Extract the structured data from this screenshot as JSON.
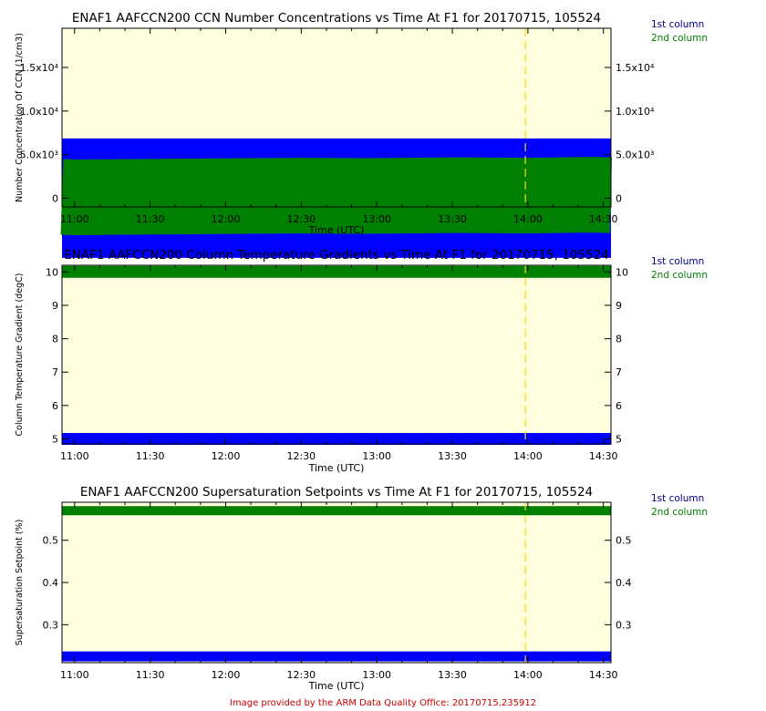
{
  "colors": {
    "plot_bg": "#ffffe0",
    "first_column": "#0000ff",
    "second_column": "#008000",
    "marker_line": "#ffd700",
    "credit": "#cc0000"
  },
  "legend": {
    "first": "1st column",
    "second": "2nd column"
  },
  "credit": "Image provided by the ARM Data Quality Office: 20170715.235912",
  "chart_data": [
    {
      "type": "line",
      "title": "ENAF1 AAFCCN200 CCN Number Concentrations vs Time At F1 for 20170715, 105524",
      "xlabel": "Time (UTC)",
      "ylabel": "Number Concentration Of CCN (1/cm3)",
      "x_ticks": [
        "11:00",
        "11:30",
        "12:00",
        "12:30",
        "13:00",
        "13:30",
        "14:00",
        "14:30"
      ],
      "xlim": [
        "10:55",
        "14:33"
      ],
      "ylim": [
        -1000,
        19500
      ],
      "y_ticks_left": [
        "0",
        "5.0x10³",
        "1.0x10⁴",
        "1.5x10⁴"
      ],
      "y_ticks_right": [
        "0",
        "5.0x10³",
        "1.0x10⁴",
        "1.5x10⁴"
      ],
      "y_tick_values": [
        0,
        5000,
        10000,
        15000
      ],
      "marker_time": "13:59",
      "series": [
        {
          "name": "1st column",
          "x": [
            "10:55",
            "14:33"
          ],
          "y": [
            0,
            0
          ]
        },
        {
          "name": "2nd column",
          "x": [
            "10:55",
            "11:00",
            "12:30",
            "12:55",
            "13:30",
            "14:00",
            "14:25",
            "14:33"
          ],
          "y": [
            150,
            100,
            300,
            250,
            350,
            300,
            400,
            350
          ]
        }
      ],
      "legend_position": "right"
    },
    {
      "type": "line",
      "title": "ENAF1 AAFCCN200 Column Temperature Gradients vs Time At F1 for 20170715, 105524",
      "xlabel": "Time (UTC)",
      "ylabel": "Column Temperature Gradient (degC)",
      "x_ticks": [
        "11:00",
        "11:30",
        "12:00",
        "12:30",
        "13:00",
        "13:30",
        "14:00",
        "14:30"
      ],
      "xlim": [
        "10:55",
        "14:33"
      ],
      "ylim": [
        4.85,
        10.2
      ],
      "y_ticks_left": [
        "5",
        "6",
        "7",
        "8",
        "9",
        "10"
      ],
      "y_ticks_right": [
        "5",
        "6",
        "7",
        "8",
        "9",
        "10"
      ],
      "y_tick_values": [
        5,
        6,
        7,
        8,
        9,
        10
      ],
      "marker_time": "13:59",
      "series": [
        {
          "name": "1st column",
          "x": [
            "10:55",
            "14:33"
          ],
          "y": [
            5,
            5
          ]
        },
        {
          "name": "2nd column",
          "x": [
            "10:55",
            "14:33"
          ],
          "y": [
            10,
            10
          ]
        }
      ],
      "legend_position": "right"
    },
    {
      "type": "line",
      "title": "ENAF1 AAFCCN200 Supersaturation Setpoints vs Time At F1 for 20170715, 105524",
      "xlabel": "Time (UTC)",
      "ylabel": "Supersaturation Setpoint (%)",
      "x_ticks": [
        "11:00",
        "11:30",
        "12:00",
        "12:30",
        "13:00",
        "13:30",
        "14:00",
        "14:30"
      ],
      "xlim": [
        "10:55",
        "14:33"
      ],
      "ylim": [
        0.21,
        0.59
      ],
      "y_ticks_left": [
        "0.3",
        "0.4",
        "0.5"
      ],
      "y_ticks_right": [
        "0.3",
        "0.4",
        "0.5"
      ],
      "y_tick_values": [
        0.3,
        0.4,
        0.5
      ],
      "marker_time": "13:59",
      "series": [
        {
          "name": "1st column",
          "x": [
            "10:55",
            "14:33"
          ],
          "y": [
            0.225,
            0.225
          ]
        },
        {
          "name": "2nd column",
          "x": [
            "10:55",
            "14:33"
          ],
          "y": [
            0.57,
            0.57
          ]
        }
      ],
      "legend_position": "right"
    }
  ]
}
